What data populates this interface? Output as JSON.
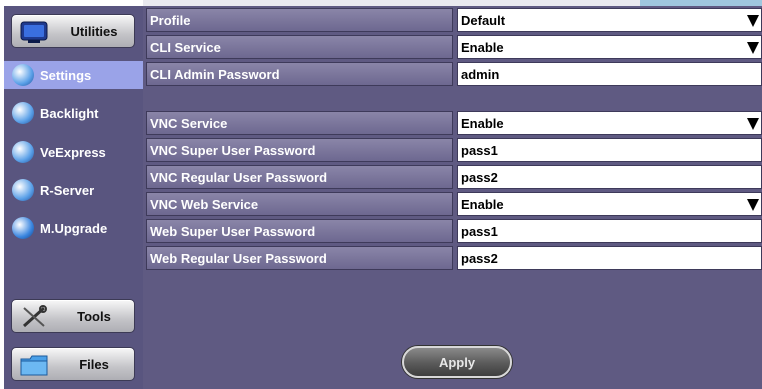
{
  "colors": {
    "sidebar_bg": "#59557f",
    "main_bg": "#5f5a82",
    "active_nav": "#9aa3e8",
    "label_bg": "#7a759c"
  },
  "sidebar": {
    "utilities_label": "Utilities",
    "tools_label": "Tools",
    "files_label": "Files",
    "items": [
      {
        "label": "Settings",
        "icon": "settings-icon",
        "active": true
      },
      {
        "label": "Backlight",
        "icon": "backlight-icon",
        "active": false
      },
      {
        "label": "VeExpress",
        "icon": "veexpress-icon",
        "active": false
      },
      {
        "label": "R-Server",
        "icon": "r-server-icon",
        "active": false
      },
      {
        "label": "M.Upgrade",
        "icon": "m-upgrade-icon",
        "active": false
      }
    ]
  },
  "settings": {
    "rows": [
      {
        "label": "Profile",
        "value": "Default",
        "dropdown": true
      },
      {
        "label": "CLI Service",
        "value": "Enable",
        "dropdown": true
      },
      {
        "label": "CLI Admin Password",
        "value": "admin",
        "dropdown": false
      },
      {
        "label": "VNC Service",
        "value": "Enable",
        "dropdown": true
      },
      {
        "label": "VNC Super User Password",
        "value": "pass1",
        "dropdown": false
      },
      {
        "label": "VNC Regular User Password",
        "value": "pass2",
        "dropdown": false
      },
      {
        "label": "VNC Web Service",
        "value": "Enable",
        "dropdown": true
      },
      {
        "label": "Web Super User Password",
        "value": "pass1",
        "dropdown": false
      },
      {
        "label": "Web Regular User Password",
        "value": "pass2",
        "dropdown": false
      }
    ]
  },
  "apply_label": "Apply"
}
